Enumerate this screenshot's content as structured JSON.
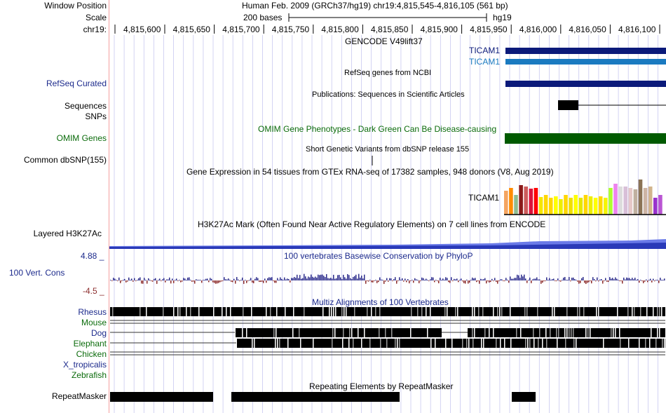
{
  "header": {
    "window_position_label": "Window Position",
    "window_position_value": "Human Feb. 2009 (GRCh37/hg19)   chr19:4,815,545-4,816,105 (561 bp)",
    "scale_label": "Scale",
    "scale_bases": "200 bases",
    "scale_assembly": "hg19",
    "chrom_label": "chr19:",
    "ticks": [
      "4,815,600",
      "4,815,650",
      "4,815,700",
      "4,815,750",
      "4,815,800",
      "4,815,850",
      "4,815,900",
      "4,815,950",
      "4,816,000",
      "4,816,050",
      "4,816,100"
    ]
  },
  "tracks": {
    "gencode": {
      "title": "GENCODE V49lift37",
      "gene1": "TICAM1",
      "gene2": "TICAM1"
    },
    "refseq": {
      "label": "RefSeq Curated",
      "title": "RefSeq genes from NCBI"
    },
    "publications": {
      "title": "Publications: Sequences in Scientific Articles"
    },
    "sequences": {
      "label": "Sequences"
    },
    "snps": {
      "label": "SNPs"
    },
    "omim": {
      "label": "OMIM Genes",
      "title": "OMIM Gene Phenotypes - Dark Green Can Be Disease-causing"
    },
    "dbsnp": {
      "label": "Common dbSNP(155)",
      "title": "Short Genetic Variants from dbSNP release 155"
    },
    "gtex": {
      "title": "Gene Expression in 54 tissues from GTEx RNA-seq of 17382 samples, 948 donors (V8, Aug 2019)",
      "gene": "TICAM1"
    },
    "h3k27ac": {
      "label": "Layered H3K27Ac",
      "title": "H3K27Ac Mark (Often Found Near Active Regulatory Elements) on 7 cell lines from ENCODE"
    },
    "cons": {
      "label": "100 Vert. Cons",
      "max": "4.88 _",
      "min": "-4.5 _",
      "title": "100 vertebrates Basewise Conservation by PhyloP"
    },
    "multiz": {
      "title": "Multiz Alignments of 100 Vertebrates",
      "species": [
        "Rhesus",
        "Mouse",
        "Dog",
        "Elephant",
        "Chicken",
        "X_tropicalis",
        "Zebrafish"
      ]
    },
    "repeatmasker": {
      "label": "RepeatMasker",
      "title": "Repeating Elements by RepeatMasker"
    }
  },
  "colors": {
    "navy": "#0b1a7a",
    "gencode_light": "#1a7ac0",
    "omim_green": "#005a00",
    "label_blue": "#1c2a8c",
    "label_green": "#0b6b0b",
    "cons_pos": "#2d2d8c",
    "cons_neg": "#8c2d2d",
    "grid": "#c8c8f0"
  }
}
